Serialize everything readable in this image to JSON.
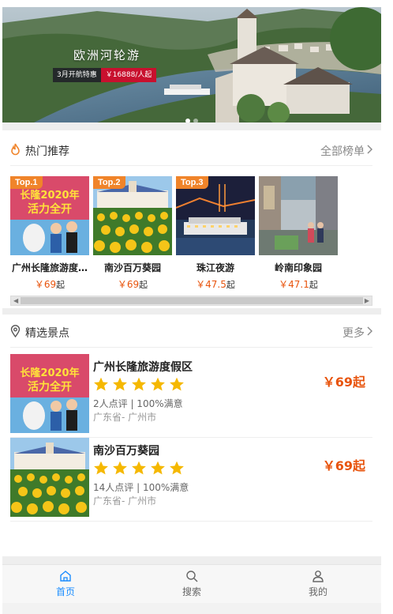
{
  "banner": {
    "title": "欧洲河轮游",
    "promo_label": "3月开航特惠",
    "promo_price": "￥16888/人起",
    "dots": 2,
    "active_dot": 1
  },
  "hot": {
    "title": "热门推荐",
    "more": "全部榜单",
    "items": [
      {
        "badge": "Top.1",
        "name": "广州长隆旅游度…",
        "price": "￥69",
        "unit": "起"
      },
      {
        "badge": "Top.2",
        "name": "南沙百万葵园",
        "price": "￥69",
        "unit": "起"
      },
      {
        "badge": "Top.3",
        "name": "珠江夜游",
        "price": "￥47.5",
        "unit": "起"
      },
      {
        "badge": "",
        "name": "岭南印象园",
        "price": "￥47.1",
        "unit": "起"
      }
    ]
  },
  "featured": {
    "title": "精选景点",
    "more": "更多",
    "items": [
      {
        "title": "广州长隆旅游度假区",
        "rating": 5,
        "reviews": "2人点评 | 100%满意",
        "region": "广东省- 广州市",
        "price": "￥69起"
      },
      {
        "title": "南沙百万葵园",
        "rating": 5,
        "reviews": "14人点评 | 100%满意",
        "region": "广东省- 广州市",
        "price": "￥69起"
      }
    ]
  },
  "tabbar": {
    "items": [
      {
        "label": "首页",
        "icon": "home-icon",
        "active": true
      },
      {
        "label": "搜索",
        "icon": "search-icon",
        "active": false
      },
      {
        "label": "我的",
        "icon": "user-icon",
        "active": false
      }
    ]
  },
  "colors": {
    "accent": "#1a8cff",
    "price": "#e8540d",
    "badge": "#f0842a",
    "star": "#f5b800"
  }
}
